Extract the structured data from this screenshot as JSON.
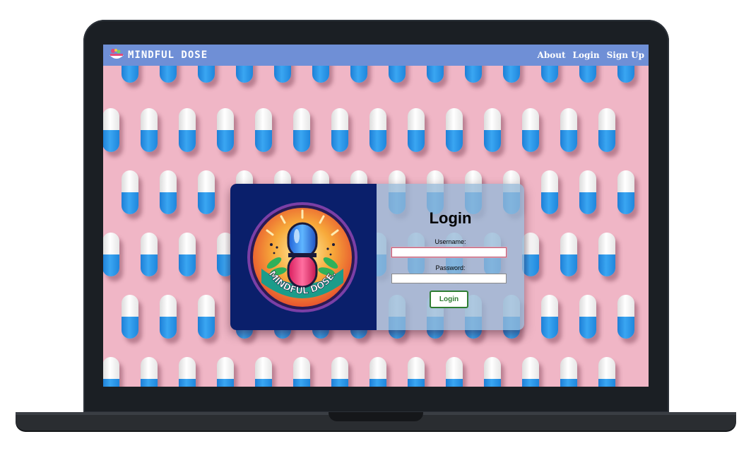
{
  "brand": {
    "name": "MINDFUL DOSE",
    "logo_icon": "pill-bowl-icon"
  },
  "nav": {
    "links": [
      {
        "label": "About"
      },
      {
        "label": "Login"
      },
      {
        "label": "Sign Up"
      }
    ]
  },
  "login": {
    "title": "Login",
    "username_label": "Username:",
    "username_value": "",
    "password_label": "Password:",
    "password_value": "",
    "submit_label": "Login"
  },
  "logo": {
    "text": "MINDFUL DOSE.",
    "icon": "capsule-badge-icon"
  },
  "colors": {
    "nav_bg": "#6f8fd6",
    "page_bg": "#f0b6c6",
    "card_left": "#0a1f6b",
    "button_accent": "#2e7d32"
  }
}
